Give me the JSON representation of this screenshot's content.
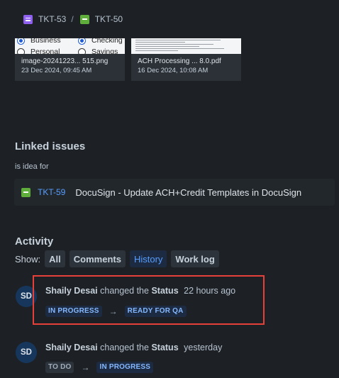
{
  "breadcrumb": {
    "parent_key": "TKT-53",
    "separator": "/",
    "current_key": "TKT-50",
    "parent_icon": "idea-icon",
    "current_icon": "story-icon"
  },
  "attachments": [
    {
      "filename": "image-20241223... 515.png",
      "date": "23 Dec 2024, 09:45 AM",
      "preview_text": [
        "Business",
        "Checking",
        "Personal",
        "Savings"
      ]
    },
    {
      "filename": "ACH Processing ... 8.0.pdf",
      "date": "16 Dec 2024, 10:08 AM"
    }
  ],
  "linked_issues": {
    "heading": "Linked issues",
    "link_type": "is idea for",
    "items": [
      {
        "key": "TKT-59",
        "summary": "DocuSign - Update ACH+Credit Templates in DocuSign",
        "icon": "story-icon"
      }
    ]
  },
  "activity": {
    "heading": "Activity",
    "show_label": "Show:",
    "filters": [
      "All",
      "Comments",
      "History",
      "Work log"
    ],
    "selected_filter": "History",
    "entries": [
      {
        "initials": "SD",
        "author": "Shaily Desai",
        "action": "changed the",
        "field": "Status",
        "when": "22 hours ago",
        "from": "IN PROGRESS",
        "to": "READY FOR QA",
        "highlighted": true
      },
      {
        "initials": "SD",
        "author": "Shaily Desai",
        "action": "changed the",
        "field": "Status",
        "when": "yesterday",
        "from": "TO DO",
        "to": "IN PROGRESS",
        "highlighted": false
      }
    ]
  },
  "colors": {
    "background": "#1d2125",
    "link_blue": "#579dff",
    "highlight_border": "#e5403a",
    "idea_icon": "#8f5ff0",
    "story_icon": "#5fae3c"
  },
  "arrow_glyph": "→"
}
